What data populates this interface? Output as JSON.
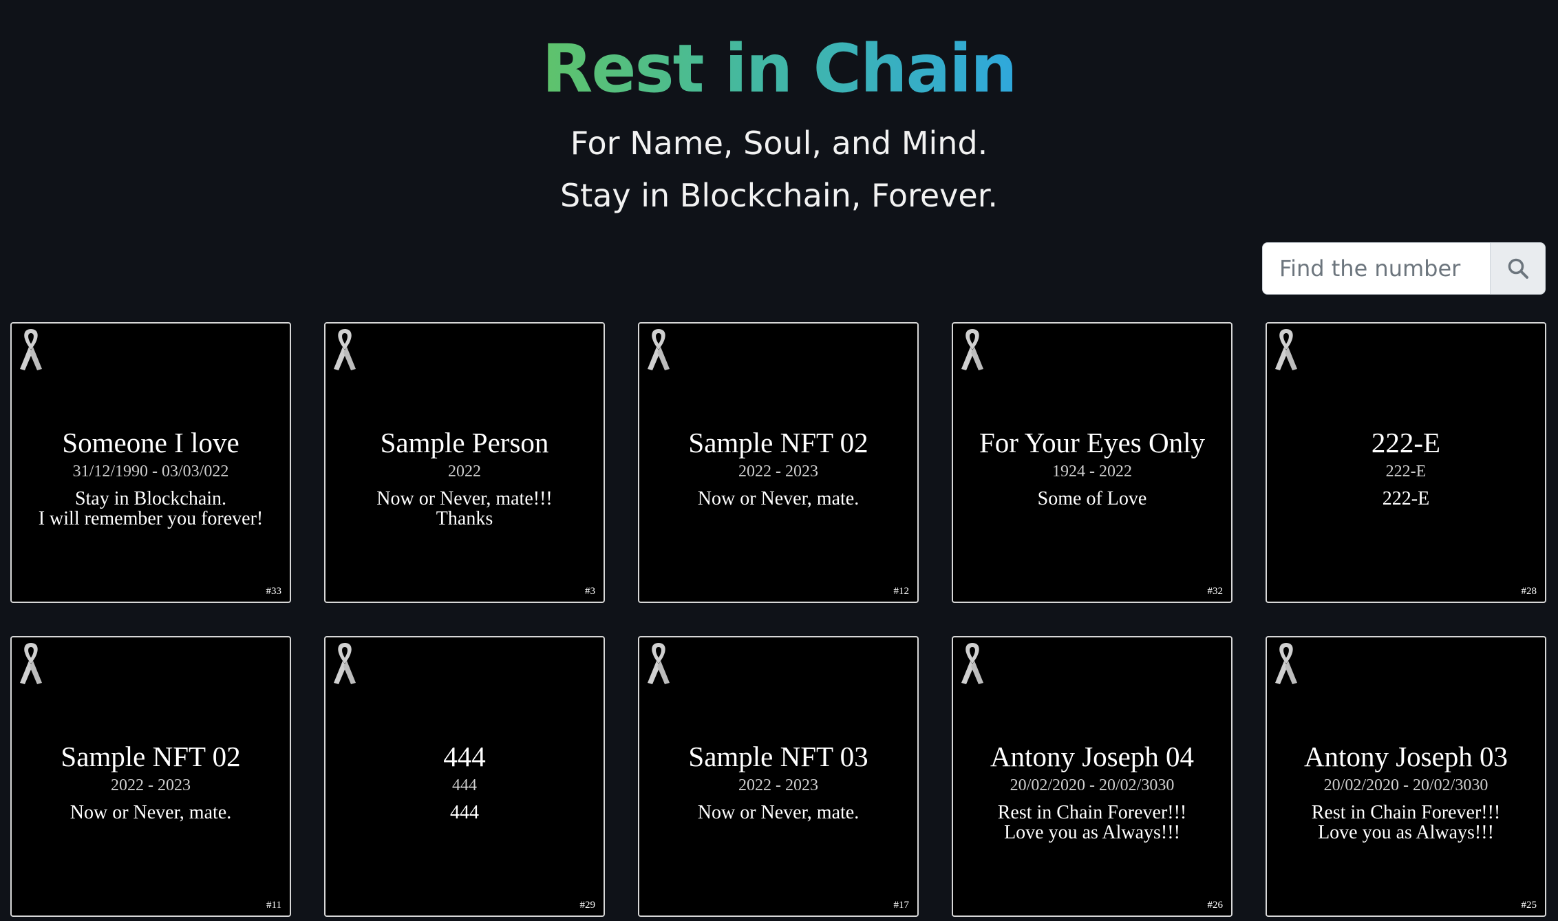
{
  "header": {
    "title": "Rest in Chain",
    "tagline_1": "For Name, Soul, and Mind.",
    "tagline_2": "Stay in Blockchain, Forever."
  },
  "search": {
    "placeholder": "Find the number",
    "button_icon": "search-icon"
  },
  "colors": {
    "background": "#0f1218",
    "title_gradient_start": "#5fc36b",
    "title_gradient_end": "#2fa8dc",
    "card_background": "#000000",
    "card_border": "#d8d8d8"
  },
  "cards": [
    {
      "name": "Someone I love",
      "dates": "31/12/1990 - 03/03/022",
      "message": "Stay in Blockchain.\nI will remember you forever!",
      "id": "#33"
    },
    {
      "name": "Sample Person",
      "dates": "2022",
      "message": "Now or Never, mate!!!\nThanks",
      "id": "#3"
    },
    {
      "name": "Sample NFT 02",
      "dates": "2022 - 2023",
      "message": "Now or Never, mate.",
      "id": "#12"
    },
    {
      "name": "For Your Eyes Only",
      "dates": "1924 - 2022",
      "message": "Some of Love",
      "id": "#32"
    },
    {
      "name": "222-E",
      "dates": "222-E",
      "message": "222-E",
      "id": "#28"
    },
    {
      "name": "Sample NFT 02",
      "dates": "2022 - 2023",
      "message": "Now or Never, mate.",
      "id": "#11"
    },
    {
      "name": "444",
      "dates": "444",
      "message": "444",
      "id": "#29"
    },
    {
      "name": "Sample NFT 03",
      "dates": "2022 - 2023",
      "message": "Now or Never, mate.",
      "id": "#17"
    },
    {
      "name": "Antony Joseph 04",
      "dates": "20/02/2020 - 20/02/3030",
      "message": "Rest in Chain Forever!!!\nLove you as Always!!!",
      "id": "#26"
    },
    {
      "name": "Antony Joseph 03",
      "dates": "20/02/2020 - 20/02/3030",
      "message": "Rest in Chain Forever!!!\nLove you as Always!!!",
      "id": "#25"
    }
  ],
  "card_icon": "awareness-ribbon-icon"
}
